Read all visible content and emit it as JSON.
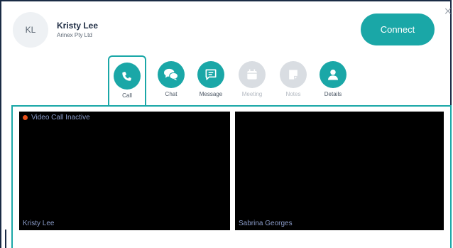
{
  "contact": {
    "initials": "KL",
    "name": "Kristy Lee",
    "company": "Arinex Pty Ltd"
  },
  "actions": {
    "connect_label": "Connect",
    "close_glyph": "×"
  },
  "tabs": [
    {
      "label": "Call",
      "icon": "phone-icon",
      "active": true,
      "enabled": true
    },
    {
      "label": "Chat",
      "icon": "chat-bubbles-icon",
      "active": false,
      "enabled": true
    },
    {
      "label": "Message",
      "icon": "message-icon",
      "active": false,
      "enabled": true
    },
    {
      "label": "Meeting",
      "icon": "calendar-icon",
      "active": false,
      "enabled": false
    },
    {
      "label": "Notes",
      "icon": "note-icon",
      "active": false,
      "enabled": false
    },
    {
      "label": "Details",
      "icon": "person-icon",
      "active": false,
      "enabled": true
    }
  ],
  "video": {
    "status": "Video Call Inactive",
    "left_name": "Kristy Lee",
    "right_name": "Sabrina Georges"
  },
  "colors": {
    "accent": "#1aa7a7",
    "disabled": "#d9dde2",
    "status_dot": "#e8501a"
  }
}
